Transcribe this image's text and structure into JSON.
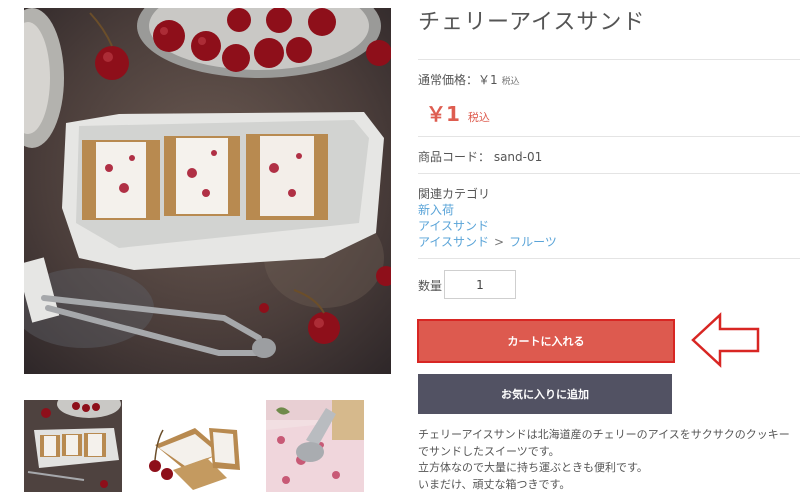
{
  "product": {
    "title": "チェリーアイスサンド",
    "regular_price_label": "通常価格：￥1",
    "regular_price_tax": "税込",
    "sale_price": "￥1",
    "sale_price_tax": "税込",
    "code_label": "商品コード： sand-01"
  },
  "category": {
    "heading": "関連カテゴリ",
    "links": [
      {
        "parts": [
          "新入荷"
        ]
      },
      {
        "parts": [
          "アイスサンド"
        ]
      },
      {
        "parts": [
          "アイスサンド",
          "フルーツ"
        ]
      }
    ],
    "separator": ">"
  },
  "quantity": {
    "label": "数量",
    "value": "1"
  },
  "buttons": {
    "add_to_cart": "カートに入れる",
    "favorite": "お気に入りに追加"
  },
  "description": [
    "チェリーアイスサンドは北海道産のチェリーのアイスをサクサクのクッキー",
    "でサンドしたスイーツです。",
    "立方体なので大量に持ち運ぶときも便利です。",
    "いまだけ、頑丈な箱つきです。"
  ],
  "icons": {
    "annotation_arrow": "arrow-left-outline-icon"
  },
  "colors": {
    "accent": "#dd5a4f",
    "highlight_border": "#d82623",
    "secondary_button": "#525263",
    "link": "#5aa4d8"
  }
}
